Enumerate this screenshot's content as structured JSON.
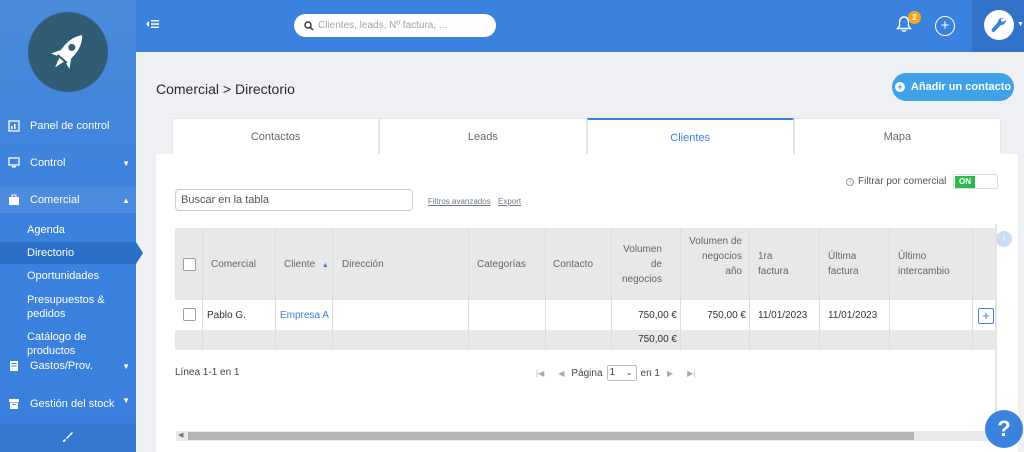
{
  "sidebar": {
    "nav": [
      {
        "label": "Panel de control",
        "icon": "dashboard-icon"
      },
      {
        "label": "Control",
        "icon": "monitor-icon"
      },
      {
        "label": "Comercial",
        "icon": "briefcase-icon"
      },
      {
        "label": "Gastos/Prov.",
        "icon": "receipt-icon"
      },
      {
        "label": "Gestión del stock",
        "icon": "archive-icon"
      }
    ],
    "subitems": [
      "Agenda",
      "Directorio",
      "Oportunidades",
      "Presupuestos & pedidos",
      "Catálogo de productos"
    ],
    "sub_selected": "Directorio"
  },
  "topbar": {
    "search_placeholder": "Clientes, leads, Nº factura, ...",
    "notification_count": "2"
  },
  "page": {
    "breadcrumb": "Comercial > Directorio",
    "add_button": "Añadir un contacto",
    "tabs": [
      "Contactos",
      "Leads",
      "Clientes",
      "Mapa"
    ],
    "active_tab": "Clientes"
  },
  "table_tools": {
    "search_placeholder": "Buscar en la tabla",
    "advanced_filters": "Filtros avanzados",
    "export": "Export",
    "filter_label": "Filtrar por comercial",
    "toggle_label": "ON"
  },
  "table": {
    "columns": [
      "Comercial",
      "Cliente",
      "Dirección",
      "Categorías",
      "Contacto",
      "Volumen de negocios",
      "Volumen de negocios año",
      "1ra factura",
      "Última factura",
      "Último intercambio"
    ],
    "rows": [
      {
        "comercial": "Pablo G.",
        "cliente": "Empresa A",
        "direccion": "",
        "categorias": "",
        "contacto": "",
        "volumen": "750,00 €",
        "volumen_ano": "750,00 €",
        "primera_factura": "11/01/2023",
        "ultima_factura": "11/01/2023",
        "ultimo_intercambio": ""
      }
    ],
    "totals": {
      "volumen": "750,00 €"
    }
  },
  "footer": {
    "line_info": "Línea 1-1 en 1",
    "page_label": "Página",
    "page_value": "1",
    "of_label": "en 1"
  },
  "colors": {
    "primary": "#3b82de",
    "accent": "#3fa2e8",
    "toggle_on": "#2eb84b",
    "badge": "#f5a623"
  }
}
